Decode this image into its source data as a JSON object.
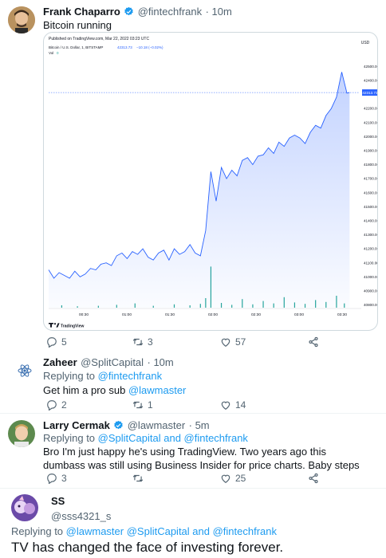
{
  "tweet1": {
    "name": "Frank Chaparro",
    "handle": "@fintechfrank",
    "time": "· 10m",
    "text": "Bitcoin running",
    "replies": "5",
    "retweets": "3",
    "likes": "57"
  },
  "tv": {
    "published": "Published on TradingView.com, Mar 22, 2022 03:23 UTC",
    "symbol": "Bitcoin / U.S. Dollar, 1, BITSTAMP",
    "price": "42313.73",
    "change": "−10.18 (−0.02%)",
    "vol": "Vol",
    "vol_val": "0",
    "currency": "USD",
    "price_tag": "42313.73",
    "brand": "TradingView",
    "accent": "#1e53e5",
    "line_color": "#2962ff",
    "vol_color": "#26a69a"
  },
  "chart_data": {
    "type": "area",
    "x_ticks": [
      "00:30",
      "01:00",
      "01:30",
      "02:00",
      "02:30",
      "03:00",
      "03:30"
    ],
    "y_ticks": [
      "42500.00",
      "42400.00",
      "42300.00",
      "42200.00",
      "42100.00",
      "42000.00",
      "41900.00",
      "41800.00",
      "41700.00",
      "41600.00",
      "41500.00",
      "41400.00",
      "41300.00",
      "41200.00",
      "41100.00",
      "41000.00",
      "40900.00",
      "40800.00"
    ],
    "ylim": [
      40780,
      42570
    ],
    "xlim": [
      0,
      230
    ],
    "last_price_line": 42313.73,
    "series": [
      {
        "name": "Bitcoin / U.S. Dollar",
        "x": [
          0,
          4,
          8,
          12,
          16,
          20,
          24,
          28,
          32,
          36,
          40,
          44,
          48,
          52,
          56,
          60,
          64,
          68,
          72,
          76,
          80,
          84,
          88,
          92,
          96,
          100,
          104,
          108,
          112,
          116,
          120,
          124,
          128,
          132,
          136,
          140,
          144,
          148,
          152,
          156,
          160,
          164,
          168,
          172,
          176,
          180,
          184,
          188,
          192,
          196,
          200,
          204,
          208,
          212,
          216,
          220,
          224,
          228,
          230
        ],
        "values": [
          41050,
          40990,
          41030,
          41010,
          40990,
          41040,
          41000,
          41020,
          41060,
          41050,
          41090,
          41100,
          41080,
          41150,
          41170,
          41130,
          41180,
          41160,
          41200,
          41140,
          41120,
          41170,
          41190,
          41120,
          41200,
          41160,
          41180,
          41230,
          41170,
          41150,
          41330,
          41750,
          41540,
          41780,
          41700,
          41760,
          41720,
          41830,
          41850,
          41800,
          41860,
          41870,
          41920,
          41880,
          41960,
          41930,
          41990,
          42010,
          41990,
          41950,
          42030,
          42080,
          42060,
          42150,
          42200,
          42280,
          42460,
          42310,
          42313.73
        ]
      }
    ],
    "volume": {
      "x": [
        10,
        22,
        38,
        52,
        66,
        80,
        96,
        108,
        116,
        120,
        124,
        132,
        140,
        148,
        156,
        164,
        172,
        180,
        188,
        196,
        204,
        212,
        220,
        226
      ],
      "values": [
        5,
        3,
        4,
        6,
        9,
        4,
        7,
        5,
        8,
        20,
        86,
        10,
        6,
        18,
        7,
        14,
        9,
        22,
        11,
        8,
        16,
        12,
        25,
        9
      ]
    }
  },
  "reply1": {
    "name": "Zaheer",
    "handle": "@SplitCapital",
    "time": "· 10m",
    "replying_prefix": "Replying to",
    "replying_to": "@fintechfrank",
    "text": "Get him a pro sub",
    "mention": "@lawmaster",
    "replies": "2",
    "retweets": "1",
    "likes": "14"
  },
  "reply2": {
    "name": "Larry Cermak",
    "handle": "@lawmaster",
    "time": "· 5m",
    "replying_prefix": "Replying to",
    "replying_to": "@SplitCapital and @fintechfrank",
    "text": "Bro I'm just happy he's using TradingView. Two years ago this dumbass was still using Business Insider for price charts. Baby steps",
    "replies": "3",
    "retweets": "",
    "likes": "25"
  },
  "reply3": {
    "name": "SS",
    "handle": "@sss4321_s",
    "replying_prefix": "Replying to",
    "replying_to": "@lawmaster @SplitCapital and @fintechfrank",
    "text": "TV has changed the face of investing forever."
  },
  "colors": {
    "link": "#1d9bf0",
    "grey": "#536471",
    "verified": "#1d9bf0"
  }
}
